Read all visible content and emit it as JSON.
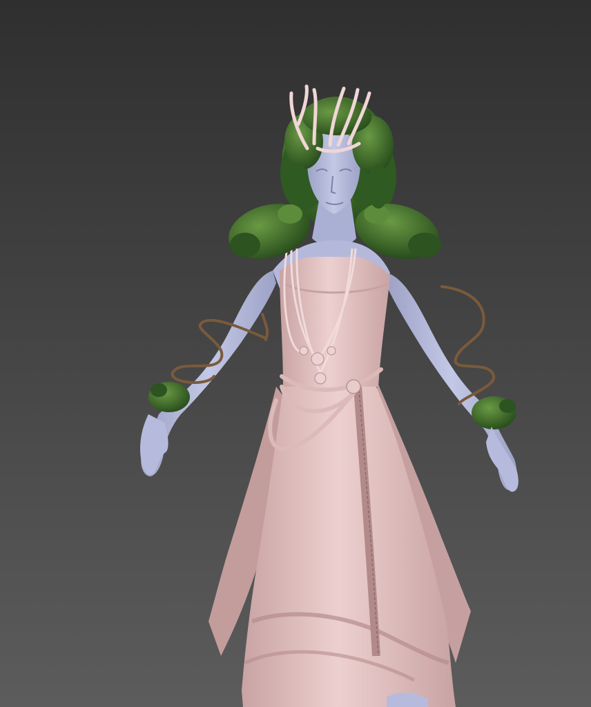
{
  "viewport": {
    "subject": "character-3d-model",
    "colors": {
      "bg_top": "#2f2f2f",
      "bg_bottom": "#5c5c5c",
      "skin": "#b9bedd",
      "skin_shade": "#8c90b4",
      "dress": "#e7c6c6",
      "dress_shade": "#c79f9f",
      "dress_dark": "#a37f80",
      "foliage": "#3f6f2a",
      "foliage_light": "#6a9a44",
      "foliage_dark": "#23451a",
      "vine": "#7a5a3c",
      "antler": "#f0d6d6"
    },
    "icons": [
      "leaf-crown-icon",
      "antler-icon",
      "necklace-icon",
      "vine-icon"
    ]
  }
}
